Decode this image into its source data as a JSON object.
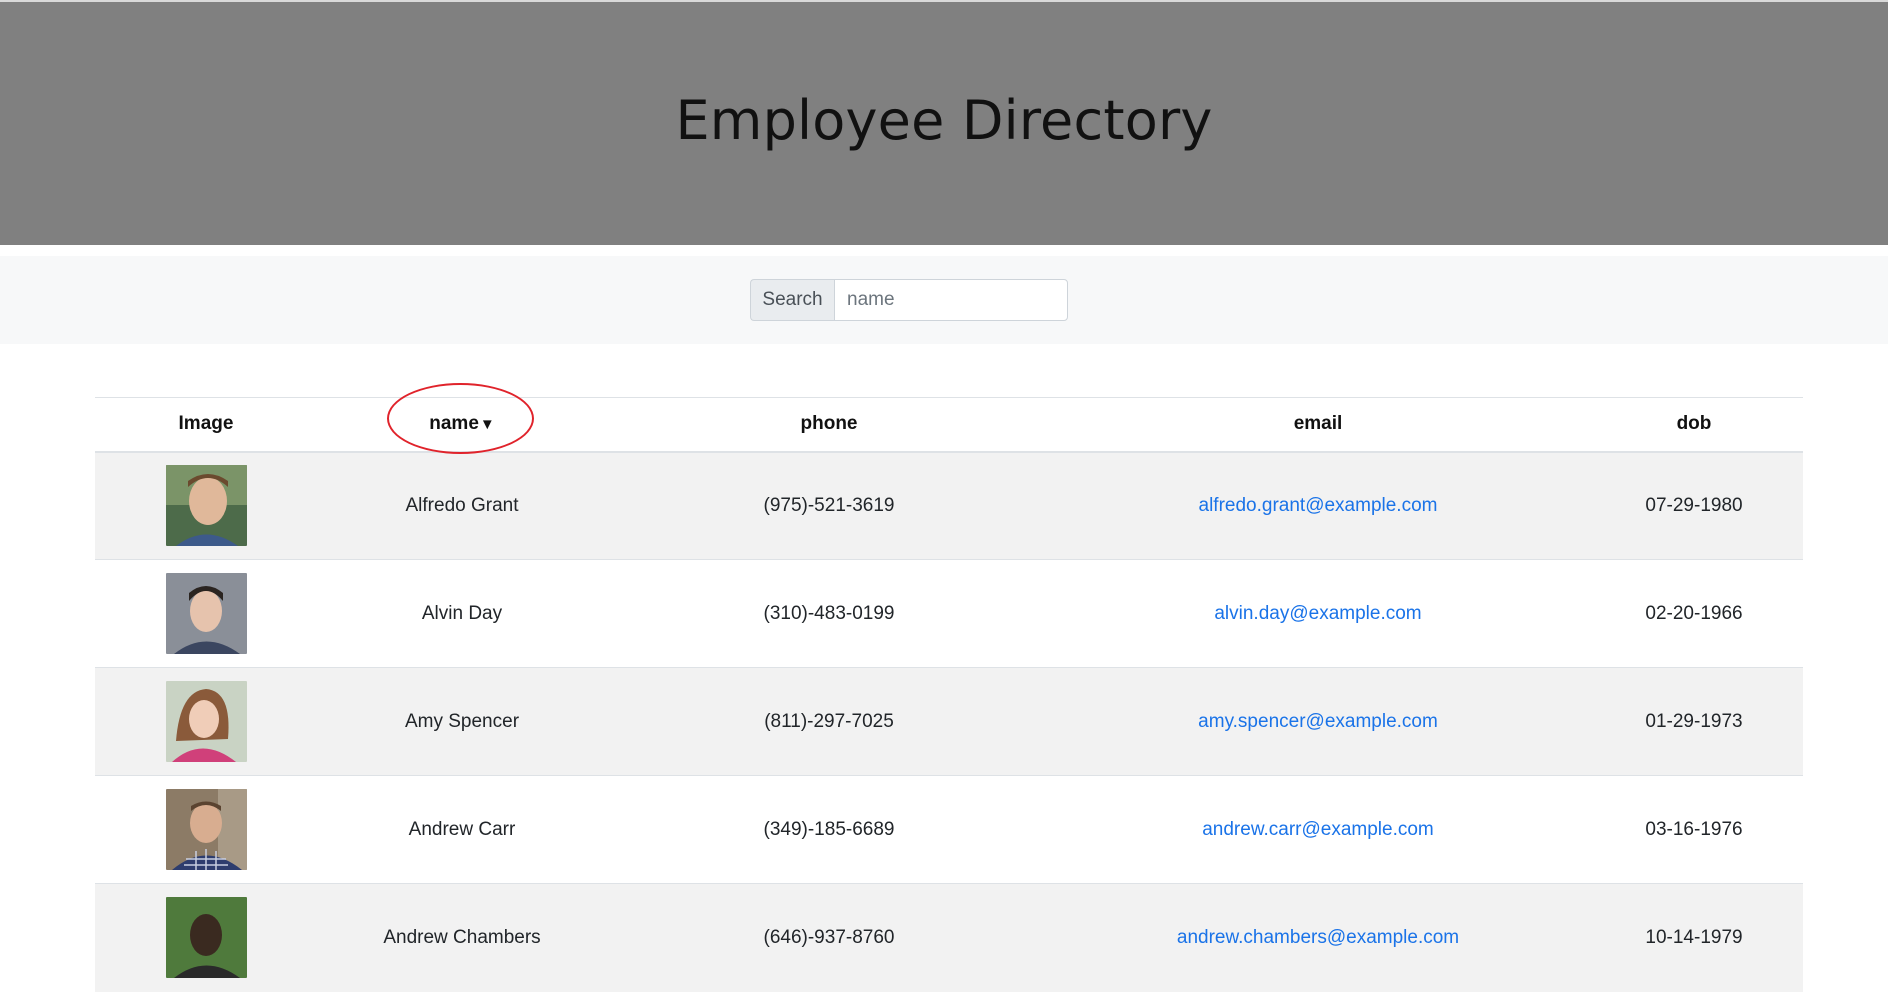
{
  "header": {
    "title": "Employee Directory"
  },
  "search": {
    "label": "Search",
    "placeholder": "name",
    "value": ""
  },
  "table": {
    "columns": [
      "Image",
      "name",
      "phone",
      "email",
      "dob"
    ],
    "sort_indicator": "▼",
    "rows": [
      {
        "name": "Alfredo Grant",
        "phone": "(975)-521-3619",
        "email": "alfredo.grant@example.com",
        "dob": "07-29-1980"
      },
      {
        "name": "Alvin Day",
        "phone": "(310)-483-0199",
        "email": "alvin.day@example.com",
        "dob": "02-20-1966"
      },
      {
        "name": "Amy Spencer",
        "phone": "(811)-297-7025",
        "email": "amy.spencer@example.com",
        "dob": "01-29-1973"
      },
      {
        "name": "Andrew Carr",
        "phone": "(349)-185-6689",
        "email": "andrew.carr@example.com",
        "dob": "03-16-1976"
      },
      {
        "name": "Andrew Chambers",
        "phone": "(646)-937-8760",
        "email": "andrew.chambers@example.com",
        "dob": "10-14-1979"
      }
    ]
  },
  "colors": {
    "header_bg": "#808080",
    "link": "#1a73e8",
    "stripe": "#f2f2f2",
    "annotation": "#e0232b"
  }
}
